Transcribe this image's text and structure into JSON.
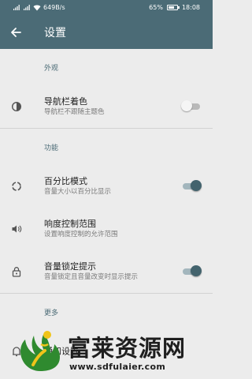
{
  "status_bar": {
    "network_speed": "649B/s",
    "battery": "65%",
    "battery_level": 0.65,
    "time": "18:08"
  },
  "app_bar": {
    "title": "设置",
    "back_icon": "arrow-left-icon"
  },
  "sections": [
    {
      "header": "外观",
      "items": [
        {
          "icon": "contrast-icon",
          "title": "导航栏着色",
          "subtitle": "导航栏不跟随主题色",
          "switch": false
        }
      ]
    },
    {
      "header": "功能",
      "items": [
        {
          "icon": "percent-ring-icon",
          "title": "百分比模式",
          "subtitle": "音量大小以百分比显示",
          "switch": true
        },
        {
          "icon": "volume-icon",
          "title": "响度控制范围",
          "subtitle": "设置响度控制的允许范围"
        },
        {
          "icon": "lock-icon",
          "title": "音量锁定提示",
          "subtitle": "音量锁定且音量改变时显示提示",
          "switch": true
        }
      ]
    },
    {
      "header": "更多",
      "items": [
        {
          "icon": "notification-icon",
          "title": "通知设置"
        }
      ]
    }
  ],
  "colors": {
    "primary": "#4b6b76",
    "accent": "#43636d",
    "background": "#ececec"
  },
  "watermark": {
    "name": "富莱资源网",
    "url": "www.sdfulaier.com"
  }
}
